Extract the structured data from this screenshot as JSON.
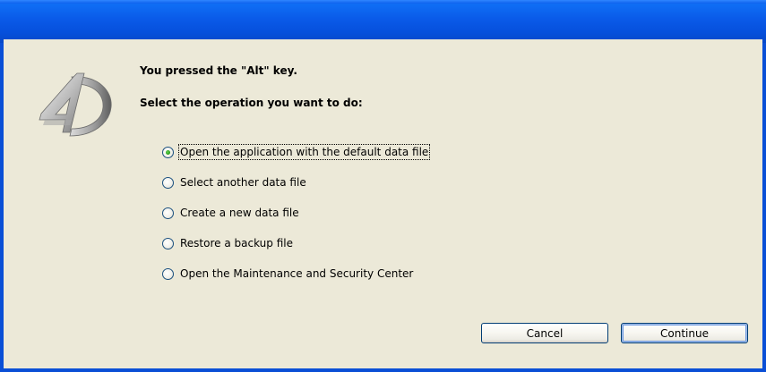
{
  "dialog": {
    "message_line1": "You pressed the \"Alt\" key.",
    "message_line2": "Select the operation you want to do:"
  },
  "options": [
    {
      "label": "Open the application with the default data file",
      "selected": true
    },
    {
      "label": "Select another data file",
      "selected": false
    },
    {
      "label": "Create a new data file",
      "selected": false
    },
    {
      "label": "Restore a backup file",
      "selected": false
    },
    {
      "label": "Open the Maintenance and Security Center",
      "selected": false
    }
  ],
  "buttons": {
    "cancel_label": "Cancel",
    "continue_label": "Continue"
  },
  "logo": {
    "name": "4D-logo"
  },
  "colors": {
    "titlebar": "#0a5ae8",
    "dialog_background": "#ece9d8",
    "button_border": "#003c74",
    "radio_selected": "#2aa11a"
  }
}
